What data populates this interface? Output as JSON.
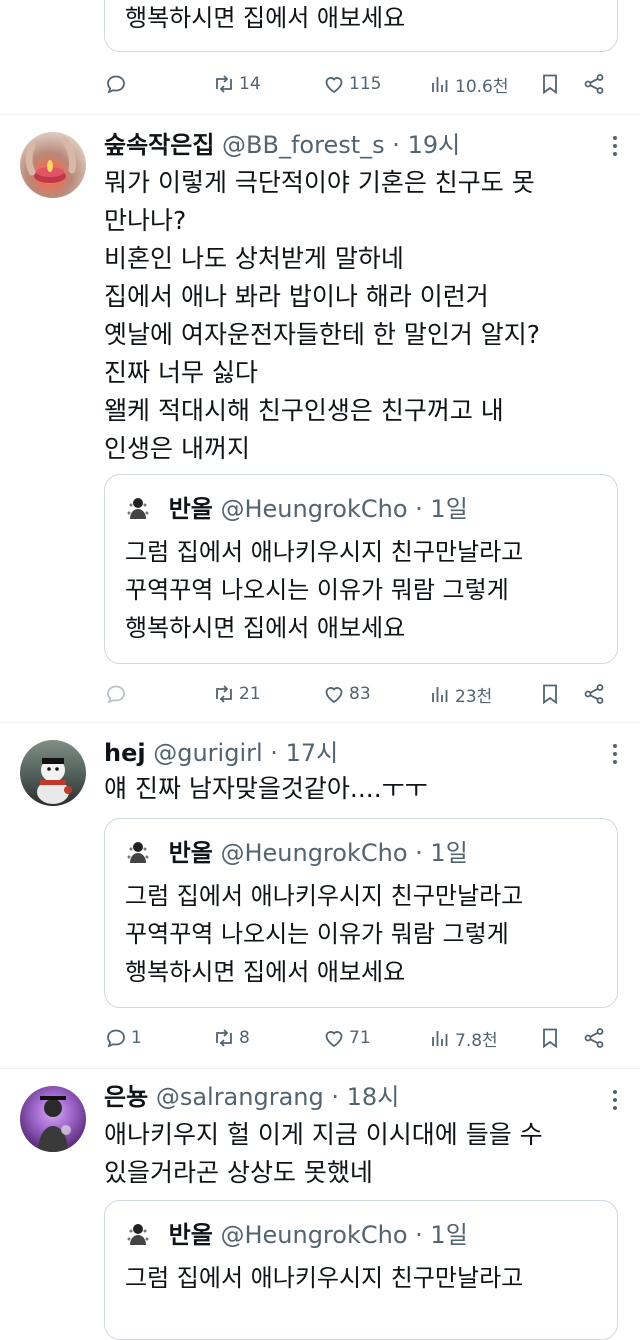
{
  "top_partial": {
    "quote_text": "행복하시면 집에서 애보세요",
    "stats": {
      "replies": "",
      "retweets": "14",
      "likes": "115",
      "views": "10.6천"
    }
  },
  "tweets": [
    {
      "username": "숲속작은집",
      "handle": "@BB_forest_s",
      "dot": "·",
      "time": "19시",
      "text": "뭐가 이렇게 극단적이야 기혼은 친구도 못\n만나나?\n비혼인 나도 상처받게 말하네\n집에서 애나 봐라 밥이나 해라 이런거\n옛날에 여자운전자들한테 한 말인거 알지?\n진짜 너무 싫다\n왤케 적대시해 친구인생은 친구꺼고 내\n인생은 내꺼지",
      "quote": {
        "username": "반올",
        "handle": "@HeungrokCho",
        "dot": "·",
        "time": "1일",
        "text": "그럼 집에서 애나키우시지 친구만날라고\n꾸역꾸역 나오시는 이유가 뭐람 그렇게\n행복하시면 집에서 애보세요"
      },
      "stats": {
        "replies": "",
        "retweets": "21",
        "likes": "83",
        "views": "23천"
      }
    },
    {
      "username": "hej",
      "handle": "@gurigirl",
      "dot": "·",
      "time": "17시",
      "text": "얘 진짜 남자맞을것같아....ㅜㅜ",
      "quote": {
        "username": "반올",
        "handle": "@HeungrokCho",
        "dot": "·",
        "time": "1일",
        "text": "그럼 집에서 애나키우시지 친구만날라고\n꾸역꾸역 나오시는 이유가 뭐람 그렇게\n행복하시면 집에서 애보세요"
      },
      "stats": {
        "replies": "1",
        "retweets": "8",
        "likes": "71",
        "views": "7.8천"
      }
    },
    {
      "username": "은뇽",
      "handle": "@salrangrang",
      "dot": "·",
      "time": "18시",
      "text": "애나키우지 헐 이게 지금 이시대에 들을 수\n있을거라곤 상상도 못했네",
      "quote": {
        "username": "반올",
        "handle": "@HeungrokCho",
        "dot": "·",
        "time": "1일",
        "text": "그럼 집에서 애나키우시지 친구만날라고"
      }
    }
  ],
  "colors": {
    "text": "#0f1419",
    "secondary": "#536471",
    "border": "#cfd9de"
  }
}
